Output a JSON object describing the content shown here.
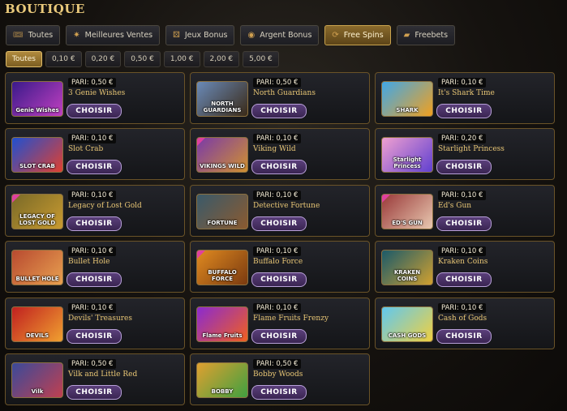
{
  "header": {
    "title": "BOUTIQUE"
  },
  "tabs": [
    {
      "label": "Toutes",
      "icon": "ticket-icon",
      "glyph": "🎟",
      "active": false
    },
    {
      "label": "Meilleures Ventes",
      "icon": "sparkle-icon",
      "glyph": "✷",
      "active": false
    },
    {
      "label": "Jeux Bonus",
      "icon": "dice-icon",
      "glyph": "⚄",
      "active": false
    },
    {
      "label": "Argent Bonus",
      "icon": "coins-icon",
      "glyph": "◉",
      "active": false
    },
    {
      "label": "Free Spins",
      "icon": "spin-icon",
      "glyph": "⟳",
      "active": true
    },
    {
      "label": "Freebets",
      "icon": "coupon-icon",
      "glyph": "▰",
      "active": false
    }
  ],
  "filters": [
    {
      "label": "Toutes",
      "active": true
    },
    {
      "label": "0,10 €",
      "active": false
    },
    {
      "label": "0,20 €",
      "active": false
    },
    {
      "label": "0,50 €",
      "active": false
    },
    {
      "label": "1,00 €",
      "active": false
    },
    {
      "label": "2,00 €",
      "active": false
    },
    {
      "label": "5,00 €",
      "active": false
    }
  ],
  "button_label": "CHOISIR",
  "games": [
    {
      "pari": "PARI: 0,50 €",
      "name": "3 Genie Wishes",
      "thumb_text": "Genie Wishes",
      "colors": [
        "#3a1a8a",
        "#c040c0"
      ],
      "corner": false
    },
    {
      "pari": "PARI: 0,50 €",
      "name": "North Guardians",
      "thumb_text": "NORTH GUARDIANS",
      "colors": [
        "#6a8ab8",
        "#3a2a18"
      ],
      "corner": false
    },
    {
      "pari": "PARI: 0,10 €",
      "name": "It's Shark Time",
      "thumb_text": "SHARK",
      "colors": [
        "#40a8e8",
        "#f0a020"
      ],
      "corner": false
    },
    {
      "pari": "PARI: 0,10 €",
      "name": "Slot Crab",
      "thumb_text": "SLOT CRAB",
      "colors": [
        "#2050d0",
        "#e04030"
      ],
      "corner": false
    },
    {
      "pari": "PARI: 0,10 €",
      "name": "Viking Wild",
      "thumb_text": "VIKINGS WILD",
      "colors": [
        "#7a3aa8",
        "#d09030"
      ],
      "corner": true
    },
    {
      "pari": "PARI: 0,20 €",
      "name": "Starlight Princess",
      "thumb_text": "Starlight Princess",
      "colors": [
        "#f0a0d0",
        "#6040d0"
      ],
      "corner": false
    },
    {
      "pari": "PARI: 0,10 €",
      "name": "Legacy of Lost Gold",
      "thumb_text": "LEGACY OF LOST GOLD",
      "colors": [
        "#7a6a28",
        "#c89a30"
      ],
      "corner": true
    },
    {
      "pari": "PARI: 0,10 €",
      "name": "Detective Fortune",
      "thumb_text": "FORTUNE",
      "colors": [
        "#3a5a6a",
        "#8a5a30"
      ],
      "corner": false
    },
    {
      "pari": "PARI: 0,10 €",
      "name": "Ed's Gun",
      "thumb_text": "ED'S GUN",
      "colors": [
        "#9a3a3a",
        "#e8c8b0"
      ],
      "corner": true
    },
    {
      "pari": "PARI: 0,10 €",
      "name": "Bullet Hole",
      "thumb_text": "BULLET HOLE",
      "colors": [
        "#b84a30",
        "#e8a050"
      ],
      "corner": false
    },
    {
      "pari": "PARI: 0,10 €",
      "name": "Buffalo Force",
      "thumb_text": "BUFFALO FORCE",
      "colors": [
        "#e08a20",
        "#7a3a10"
      ],
      "corner": true
    },
    {
      "pari": "PARI: 0,10 €",
      "name": "Kraken Coins",
      "thumb_text": "KRAKEN COINS",
      "colors": [
        "#1a5a6a",
        "#d0a030"
      ],
      "corner": false
    },
    {
      "pari": "PARI: 0,10 €",
      "name": "Devils' Treasures",
      "thumb_text": "DEVILS",
      "colors": [
        "#c02020",
        "#f0a030"
      ],
      "corner": false
    },
    {
      "pari": "PARI: 0,10 €",
      "name": "Flame Fruits Frenzy",
      "thumb_text": "Flame Fruits",
      "colors": [
        "#8a2ad0",
        "#f06020"
      ],
      "corner": false
    },
    {
      "pari": "PARI: 0,10 €",
      "name": "Cash of Gods",
      "thumb_text": "CASH GODS",
      "colors": [
        "#60c8f0",
        "#f0d040"
      ],
      "corner": false
    },
    {
      "pari": "PARI: 0,50 €",
      "name": "Vilk and Little Red",
      "thumb_text": "Vilk",
      "colors": [
        "#3a4a9a",
        "#c04050"
      ],
      "corner": false
    },
    {
      "pari": "PARI: 0,50 €",
      "name": "Bobby Woods",
      "thumb_text": "BOBBY",
      "colors": [
        "#e0a030",
        "#40a040"
      ],
      "corner": false
    }
  ]
}
